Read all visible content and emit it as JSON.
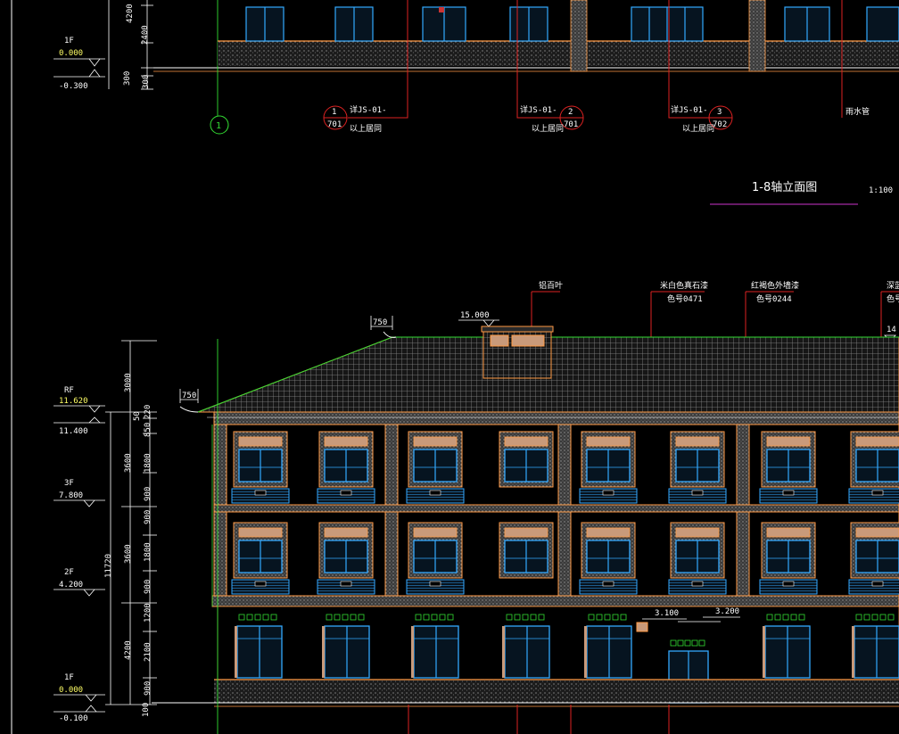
{
  "top_section": {
    "level_left": {
      "floor": "1F",
      "value": "0.000",
      "below": "-0.300"
    },
    "dims": [
      "4200",
      "2400",
      "300",
      "300"
    ],
    "axis": "1",
    "callouts": [
      {
        "ref": "详JS-01-",
        "num": "1",
        "sheet": "701",
        "note": "以上居同"
      },
      {
        "ref": "详JS-01-",
        "num": "2",
        "sheet": "701",
        "note": "以上居同"
      },
      {
        "ref": "详JS-01-",
        "num": "3",
        "sheet": "702",
        "note": "以上居同"
      }
    ],
    "drain_label": "雨水管"
  },
  "title": {
    "text": "1-8轴立面图",
    "scale": "1:100"
  },
  "elevation": {
    "labels": {
      "louver": "铝百叶",
      "stone_paint": "米白色真石漆",
      "stone_color": "色号0471",
      "red_paint": "红褐色外墙漆",
      "red_color": "色号0244",
      "deep_partial": "深蓝",
      "deep_color_partial": "色号"
    },
    "ridge_level": "15.000",
    "partial_level": "14",
    "eave_offsets": [
      "750",
      "750"
    ],
    "entrance_levels": [
      "3.100",
      "3.200"
    ],
    "left_dims": {
      "total": "11720",
      "roof": "3000",
      "floor3": "3600",
      "floor2": "3600",
      "floor1": "4200",
      "parapet": [
        "50",
        "220"
      ],
      "sub3": [
        "850",
        "1800",
        "900"
      ],
      "sub2": [
        "900",
        "1800",
        "900"
      ],
      "sub1": [
        "1200",
        "2100",
        "900"
      ],
      "base": "100"
    },
    "levels": [
      {
        "floor": "RF",
        "value": "11.620",
        "second": "11.400"
      },
      {
        "floor": "3F",
        "value": "7.800"
      },
      {
        "floor": "2F",
        "value": "4.200"
      },
      {
        "floor": "1F",
        "value": "0.000",
        "second": "-0.100"
      }
    ]
  }
}
